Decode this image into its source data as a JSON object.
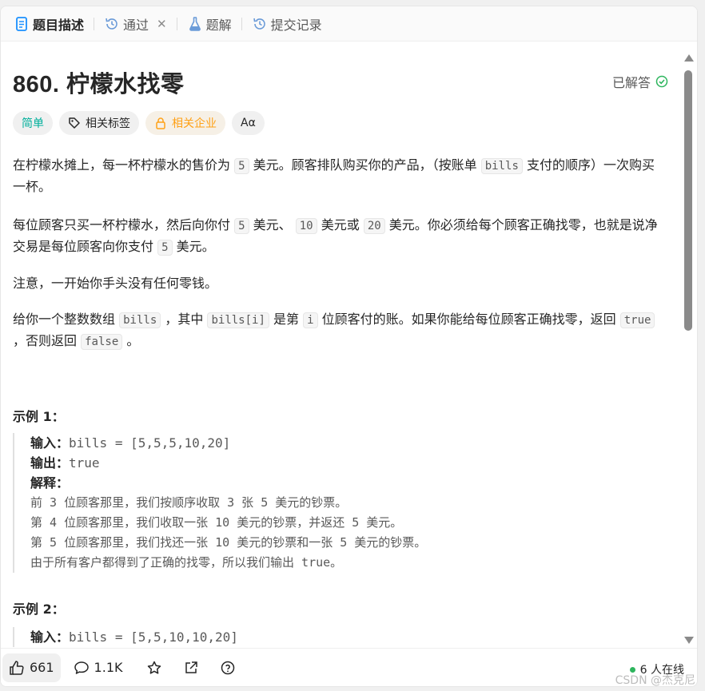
{
  "tabs": [
    {
      "label": "题目描述",
      "icon": "description-icon",
      "active": true
    },
    {
      "label": "通过",
      "icon": "history-icon",
      "closable": true
    },
    {
      "label": "题解",
      "icon": "flask-icon"
    },
    {
      "label": "提交记录",
      "icon": "history-icon"
    }
  ],
  "problem": {
    "title": "860. 柠檬水找零",
    "status": "已解答",
    "tags": {
      "difficulty": "简单",
      "related_tags": "相关标签",
      "related_companies": "相关企业",
      "font_toggle": "Aα"
    }
  },
  "description": {
    "p1": {
      "t1": "在柠檬水摊上，每一杯柠檬水的售价为",
      "c1": "5",
      "t2": "美元。顾客排队购买你的产品，（按账单",
      "c2": "bills",
      "t3": "支付的顺序）一次购买一杯。"
    },
    "p2": {
      "t1": "每位顾客只买一杯柠檬水，然后向你付",
      "c1": "5",
      "t2": "美元、",
      "c2": "10",
      "t3": "美元或",
      "c3": "20",
      "t4": "美元。你必须给每个顾客正确找零，也就是说净交易是每位顾客向你支付",
      "c4": "5",
      "t5": "美元。"
    },
    "p3": "注意，一开始你手头没有任何零钱。",
    "p4": {
      "t1": "给你一个整数数组",
      "c1": "bills",
      "t2": "，其中",
      "c2": "bills[i]",
      "t3": "是第",
      "c3": "i",
      "t4": "位顾客付的账。如果你能给每位顾客正确找零，返回",
      "c4": "true",
      "t5": "，否则返回",
      "c5": "false",
      "t6": "。"
    }
  },
  "examples": [
    {
      "title": "示例 1：",
      "input_label": "输入：",
      "input": "bills = [5,5,5,10,20]",
      "output_label": "输出：",
      "output": "true",
      "explain_label": "解释：",
      "explain": [
        "前 3 位顾客那里，我们按顺序收取 3 张 5 美元的钞票。",
        "第 4 位顾客那里，我们收取一张 10 美元的钞票，并返还 5 美元。",
        "第 5 位顾客那里，我们找还一张 10 美元的钞票和一张 5 美元的钞票。",
        "由于所有客户都得到了正确的找零，所以我们输出 true。"
      ]
    },
    {
      "title": "示例 2：",
      "input_label": "输入：",
      "input": "bills = [5,5,10,10,20]"
    }
  ],
  "bottom": {
    "likes": "661",
    "comments": "1.1K",
    "online": "6 人在线"
  },
  "watermark": "CSDN @杰克尼",
  "colors": {
    "easy": "#00af9b",
    "company": "#ffa116",
    "solved": "#2db55d",
    "tab_icon": "#1a90ff"
  }
}
